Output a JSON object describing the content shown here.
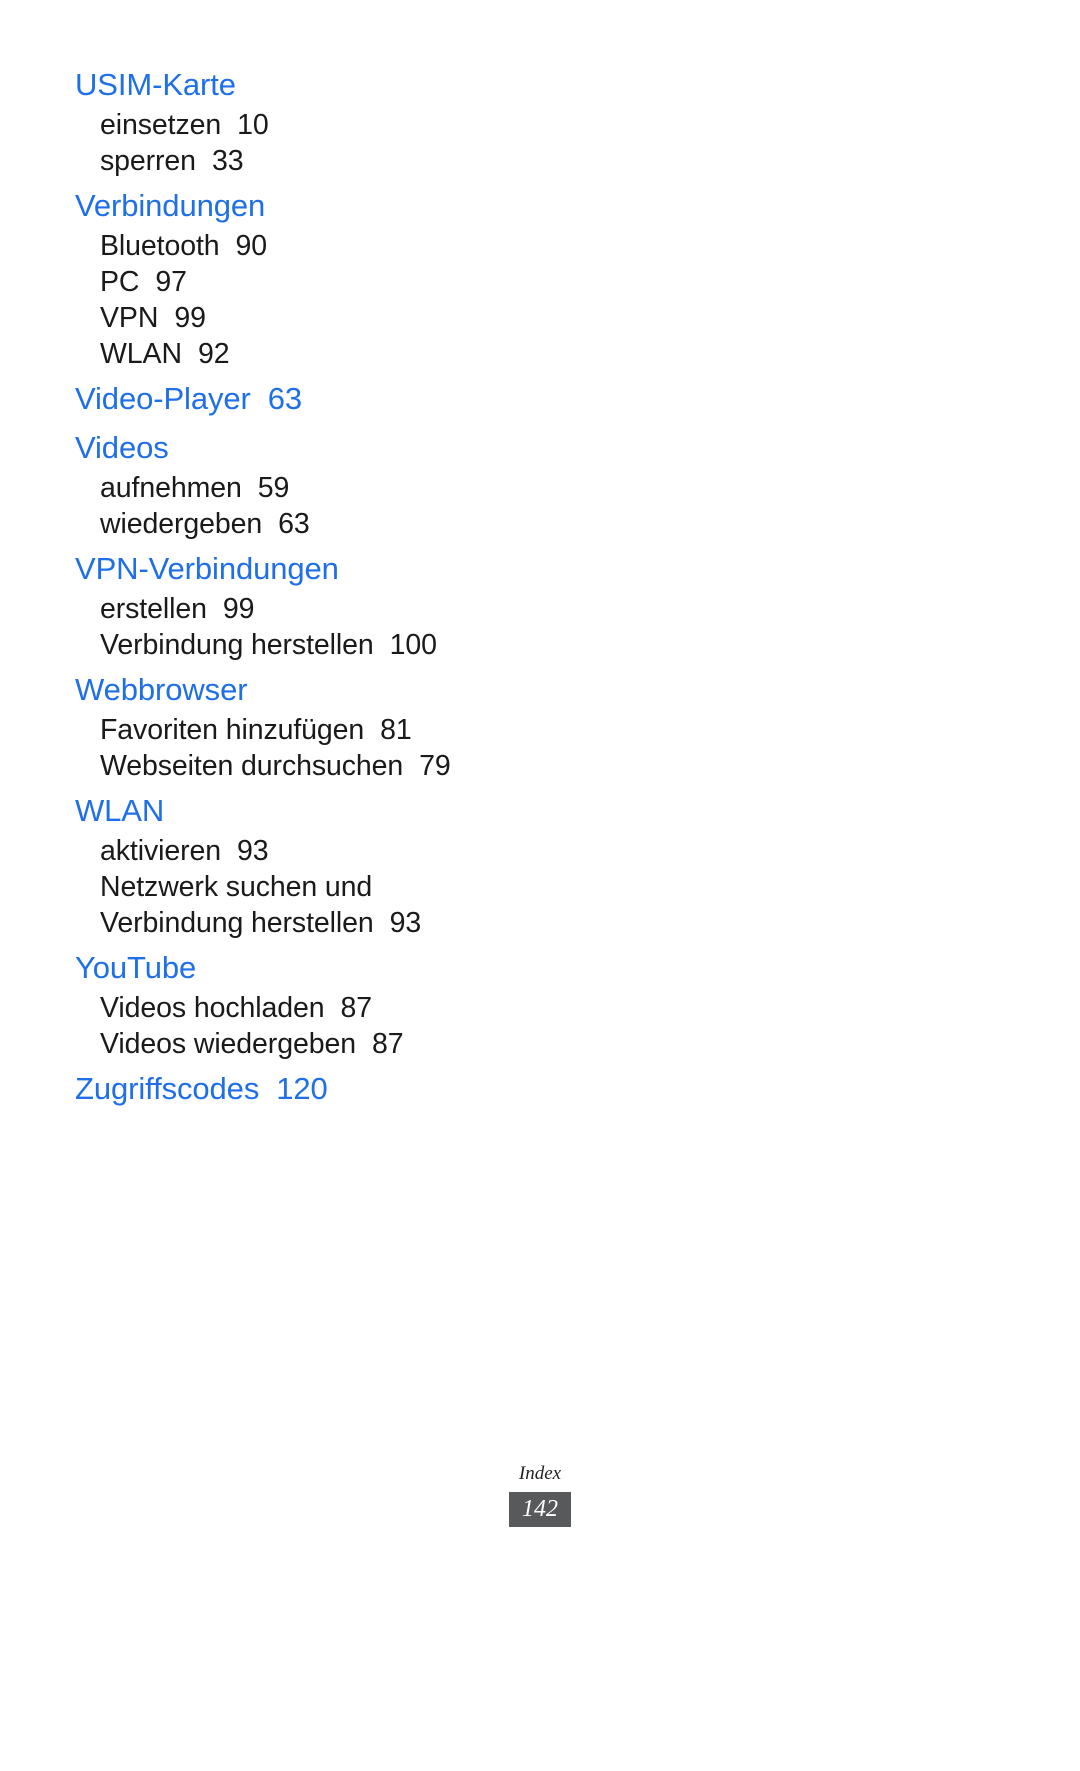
{
  "document": {
    "footer_label": "Index",
    "page_number": "142",
    "heading_color": "#1f6fe8",
    "text_color": "#1a1a1a",
    "badge_color": "#58595b"
  },
  "index": {
    "groups": [
      {
        "heading": "USIM-Karte",
        "heading_page": "",
        "entries": [
          {
            "label": "einsetzen",
            "page": "10",
            "wrapped": false
          },
          {
            "label": "sperren",
            "page": "33",
            "wrapped": false
          }
        ]
      },
      {
        "heading": "Verbindungen",
        "heading_page": "",
        "entries": [
          {
            "label": "Bluetooth",
            "page": "90",
            "wrapped": false
          },
          {
            "label": "PC",
            "page": "97",
            "wrapped": false
          },
          {
            "label": "VPN",
            "page": "99",
            "wrapped": false
          },
          {
            "label": "WLAN",
            "page": "92",
            "wrapped": false
          }
        ]
      },
      {
        "heading": "Video-Player",
        "heading_page": "63",
        "entries": []
      },
      {
        "heading": "Videos",
        "heading_page": "",
        "entries": [
          {
            "label": "aufnehmen",
            "page": "59",
            "wrapped": false
          },
          {
            "label": "wiedergeben",
            "page": "63",
            "wrapped": false
          }
        ]
      },
      {
        "heading": "VPN-Verbindungen",
        "heading_page": "",
        "entries": [
          {
            "label": "erstellen",
            "page": "99",
            "wrapped": false
          },
          {
            "label": "Verbindung herstellen",
            "page": "100",
            "wrapped": false
          }
        ]
      },
      {
        "heading": "Webbrowser",
        "heading_page": "",
        "entries": [
          {
            "label": "Favoriten hinzufügen",
            "page": "81",
            "wrapped": false
          },
          {
            "label": "Webseiten durchsuchen",
            "page": "79",
            "wrapped": false
          }
        ]
      },
      {
        "heading": "WLAN",
        "heading_page": "",
        "entries": [
          {
            "label": "aktivieren",
            "page": "93",
            "wrapped": false
          },
          {
            "label": "Netzwerk suchen und Verbindung herstellen",
            "page": "93",
            "wrapped": true
          }
        ]
      },
      {
        "heading": "YouTube",
        "heading_page": "",
        "entries": [
          {
            "label": "Videos hochladen",
            "page": "87",
            "wrapped": false
          },
          {
            "label": "Videos wiedergeben",
            "page": "87",
            "wrapped": false
          }
        ]
      },
      {
        "heading": "Zugriffscodes",
        "heading_page": "120",
        "entries": []
      }
    ]
  }
}
